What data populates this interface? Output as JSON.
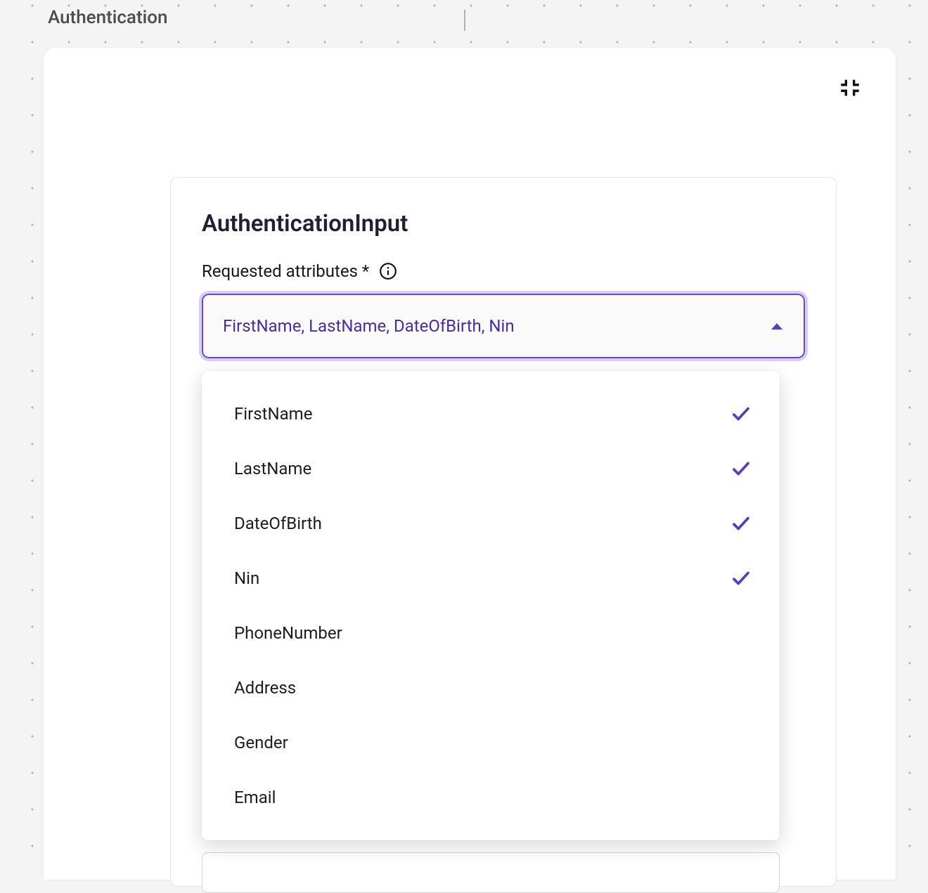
{
  "page": {
    "title": "Authentication"
  },
  "panel": {
    "title": "AuthenticationInput",
    "field_label": "Requested attributes *",
    "select_value": "FirstName, LastName, DateOfBirth, Nin",
    "options": [
      {
        "label": "FirstName",
        "selected": true
      },
      {
        "label": "LastName",
        "selected": true
      },
      {
        "label": "DateOfBirth",
        "selected": true
      },
      {
        "label": "Nin",
        "selected": true
      },
      {
        "label": "PhoneNumber",
        "selected": false
      },
      {
        "label": "Address",
        "selected": false
      },
      {
        "label": "Gender",
        "selected": false
      },
      {
        "label": "Email",
        "selected": false
      }
    ]
  },
  "colors": {
    "accent": "#5a3cc0",
    "focus_ring": "#d9ccfb"
  }
}
